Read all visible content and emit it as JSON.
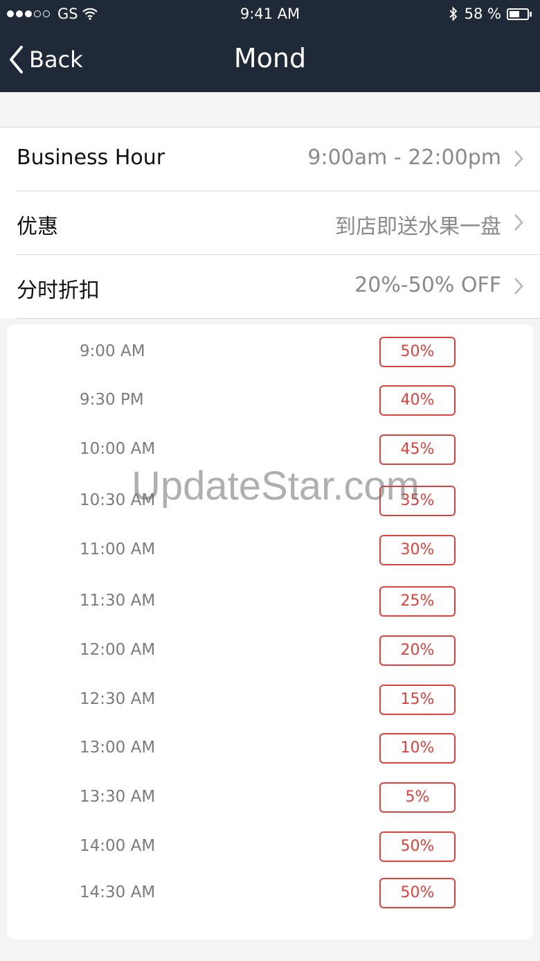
{
  "status_bar": {
    "carrier": "GS",
    "time": "9:41 AM",
    "battery": "58 %",
    "icons": [
      "signal-dots-icon",
      "wifi-icon",
      "bluetooth-icon",
      "battery-icon"
    ],
    "battery_level": 0.58
  },
  "nav": {
    "back_label": "Back",
    "title": "Mond"
  },
  "settings": [
    {
      "label": "Business Hour",
      "value": "9:00am - 22:00pm"
    },
    {
      "label": "优惠",
      "value": "到店即送水果一盘"
    },
    {
      "label": "分时折扣",
      "value": "20%-50% OFF"
    }
  ],
  "time_slots": [
    {
      "time": "9:00 AM",
      "discount": "50%"
    },
    {
      "time": "9:30 PM",
      "discount": "40%"
    },
    {
      "time": "10:00 AM",
      "discount": "45%"
    },
    {
      "time": "10:30 AM",
      "discount": "35%"
    },
    {
      "time": "11:00 AM",
      "discount": "30%"
    },
    {
      "time": "11:30 AM",
      "discount": "25%"
    },
    {
      "time": "12:00 AM",
      "discount": "20%"
    },
    {
      "time": "12:30 AM",
      "discount": "15%"
    },
    {
      "time": "13:00 AM",
      "discount": "10%"
    },
    {
      "time": "13:30 AM",
      "discount": "5%"
    },
    {
      "time": "14:00 AM",
      "discount": "50%"
    },
    {
      "time": "14:30 AM",
      "discount": "50%"
    }
  ],
  "watermark": "UpdateStar.com",
  "colors": {
    "header_bg": "#1f2937",
    "accent_red": "#e0413b",
    "page_bg": "#f4f4f4"
  }
}
